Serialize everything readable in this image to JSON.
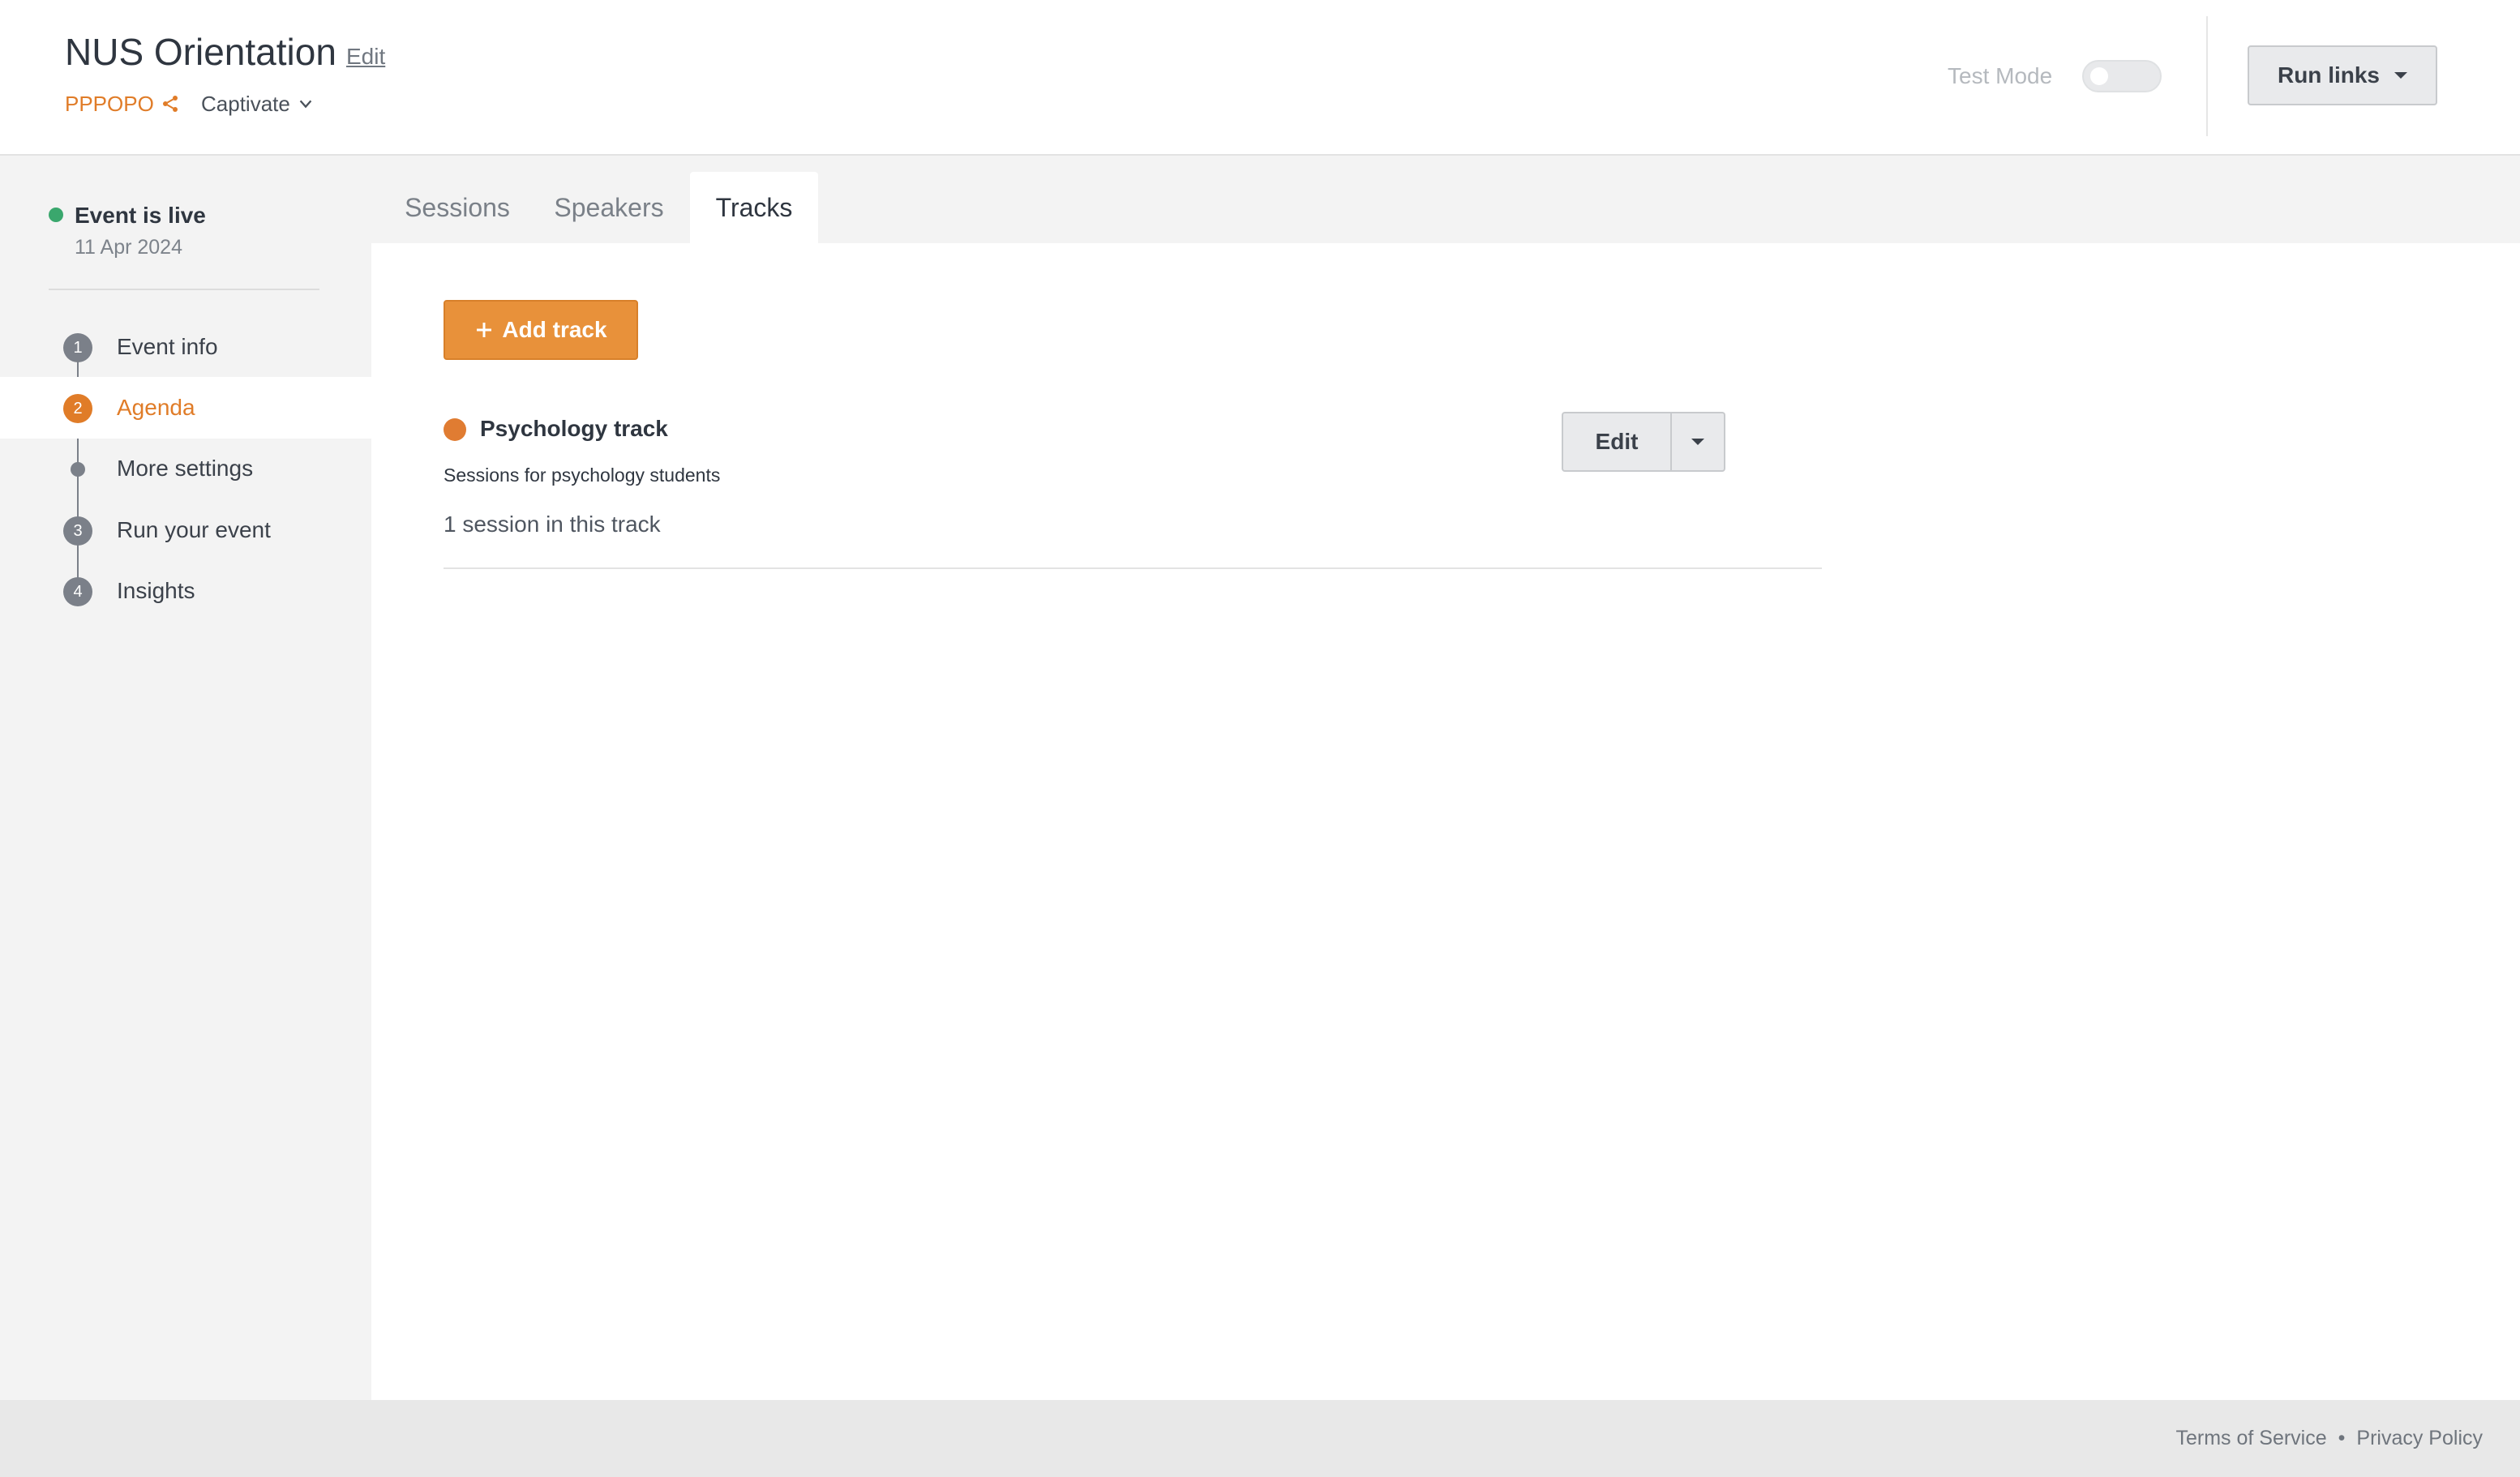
{
  "header": {
    "title": "NUS Orientation",
    "edit_label": "Edit",
    "org_name": "PPPOPO",
    "plan_name": "Captivate",
    "test_mode_label": "Test Mode",
    "test_mode_on": false,
    "run_links_label": "Run links"
  },
  "sidebar": {
    "status_label": "Event is live",
    "status_date": "11 Apr 2024",
    "status_color": "#3aa76d",
    "items": [
      {
        "badge": "1",
        "label": "Event info",
        "active": false
      },
      {
        "badge": "2",
        "label": "Agenda",
        "active": true
      },
      {
        "badge": "",
        "label": "More settings",
        "active": false
      },
      {
        "badge": "3",
        "label": "Run your event",
        "active": false
      },
      {
        "badge": "4",
        "label": "Insights",
        "active": false
      }
    ]
  },
  "main": {
    "tabs": [
      {
        "label": "Sessions",
        "active": false
      },
      {
        "label": "Speakers",
        "active": false
      },
      {
        "label": "Tracks",
        "active": true
      }
    ],
    "add_track_label": "Add track",
    "tracks": [
      {
        "name": "Psychology track",
        "description": "Sessions for psychology students",
        "session_count_text": "1 session in this track",
        "color": "#e07c32",
        "edit_label": "Edit"
      }
    ]
  },
  "footer": {
    "terms_label": "Terms of Service",
    "separator": "•",
    "privacy_label": "Privacy Policy"
  },
  "colors": {
    "accent": "#e8913a",
    "active_nav": "#e07c28"
  }
}
